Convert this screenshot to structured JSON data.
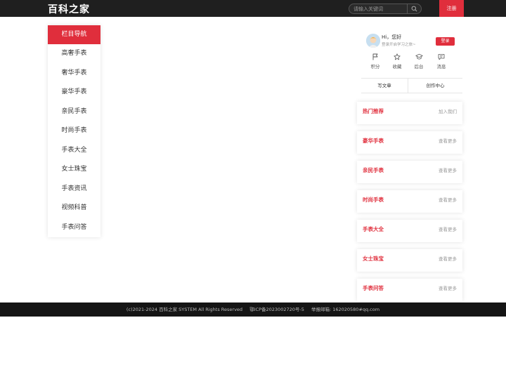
{
  "header": {
    "logo_text": "百科之家",
    "search_placeholder": "请输入关键词",
    "register_label": "注册"
  },
  "sidebar": {
    "title": "栏目导航",
    "items": [
      {
        "label": "高奢手表"
      },
      {
        "label": "奢华手表"
      },
      {
        "label": "豪华手表"
      },
      {
        "label": "亲民手表"
      },
      {
        "label": "时尚手表"
      },
      {
        "label": "手表大全"
      },
      {
        "label": "女士珠宝"
      },
      {
        "label": "手表资讯"
      },
      {
        "label": "视频科普"
      },
      {
        "label": "手表问答"
      }
    ]
  },
  "user_panel": {
    "greeting": "Hi，您好",
    "subtitle": "登录开启学习之旅~",
    "login_label": "登录",
    "actions": [
      {
        "label": "积分",
        "icon": "flag-icon"
      },
      {
        "label": "收藏",
        "icon": "star-icon"
      },
      {
        "label": "后台",
        "icon": "graduation-cap-icon"
      },
      {
        "label": "消息",
        "icon": "message-icon"
      }
    ],
    "write_article": "写文章",
    "creator_center": "创作中心"
  },
  "side_cards": [
    {
      "title": "热门推荐",
      "more": "加入我们"
    },
    {
      "title": "豪华手表",
      "more": "查看更多"
    },
    {
      "title": "亲民手表",
      "more": "查看更多"
    },
    {
      "title": "时尚手表",
      "more": "查看更多"
    },
    {
      "title": "手表大全",
      "more": "查看更多"
    },
    {
      "title": "女士珠宝",
      "more": "查看更多"
    },
    {
      "title": "手表问答",
      "more": "查看更多"
    }
  ],
  "footer": {
    "copyright": "(c)2021-2024 百科之家 SYSTEM All Rights Reserved",
    "icp": "鄂ICP备2023002720号-5",
    "report": "举报邮箱: 162020580#qq.com"
  },
  "colors": {
    "accent": "#e02e3c",
    "topbar": "#1f1f1f",
    "footer": "#151515"
  }
}
